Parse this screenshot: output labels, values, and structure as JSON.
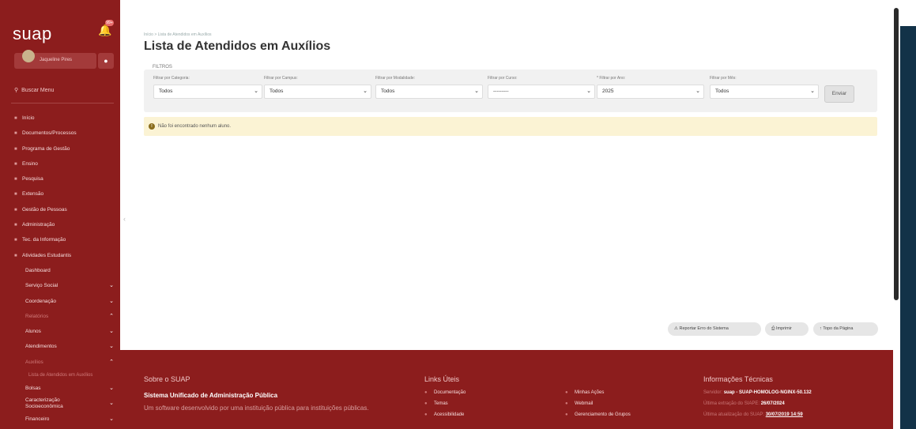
{
  "app": {
    "logo": "suap",
    "notif_badge": "99+"
  },
  "user": {
    "name": "Jaqueline Pires"
  },
  "sidebar": {
    "search_label": "Buscar Menu",
    "items": [
      {
        "label": "Início",
        "chevron": ""
      },
      {
        "label": "Documentos/Processos",
        "chevron": ""
      },
      {
        "label": "Programa de Gestão",
        "chevron": ""
      },
      {
        "label": "Ensino",
        "chevron": ""
      },
      {
        "label": "Pesquisa",
        "chevron": ""
      },
      {
        "label": "Extensão",
        "chevron": ""
      },
      {
        "label": "Gestão de Pessoas",
        "chevron": ""
      },
      {
        "label": "Administração",
        "chevron": ""
      },
      {
        "label": "Tec. da Informação",
        "chevron": ""
      },
      {
        "label": "Atividades Estudantis",
        "chevron": ""
      },
      {
        "label": "Dashboard",
        "chevron": ""
      },
      {
        "label": "Serviço Social",
        "chevron": "⌄"
      },
      {
        "label": "Coordenação",
        "chevron": "⌄"
      },
      {
        "label": "Relatórios",
        "chevron": "⌃"
      },
      {
        "label": "Alunos",
        "chevron": "⌄"
      },
      {
        "label": "Atendimentos",
        "chevron": "⌄"
      },
      {
        "label": "Auxílios",
        "chevron": "⌃"
      },
      {
        "label": "Lista de Atendidos em Auxílios",
        "chevron": ""
      },
      {
        "label": "Bolsas",
        "chevron": "⌄"
      },
      {
        "label": "Caracterização Socioeconômica",
        "chevron": "⌄"
      },
      {
        "label": "Financeiro",
        "chevron": "⌄"
      }
    ]
  },
  "breadcrumb": "Início > Lista de Atendidos em Auxílios",
  "page_title": "Lista de Atendidos em Auxílios",
  "filters": {
    "section_label": "FILTROS",
    "categoria": {
      "label": "Filtrar por Categoria:",
      "value": "Todos"
    },
    "campus": {
      "label": "Filtrar por Campus:",
      "value": "Todos"
    },
    "modalidade": {
      "label": "Filtrar por Modalidade:",
      "value": "Todos"
    },
    "curso": {
      "label": "Filtrar por Curso:",
      "value": "---------"
    },
    "ano": {
      "label": "* Filtrar por Ano:",
      "value": "2025"
    },
    "mes": {
      "label": "Filtrar por Mês:",
      "value": "Todos"
    },
    "submit": "Enviar"
  },
  "alert": "Não foi encontrado nenhum aluno.",
  "actions": {
    "report": "Reportar Erro do Sistema",
    "print": "Imprimir",
    "top": "Topo da Página"
  },
  "footer": {
    "about_title": "Sobre o SUAP",
    "about_name": "Sistema Unificado de Administração Pública",
    "about_desc": "Um software desenvolvido por uma instituição pública para instituições públicas.",
    "links_title": "Links Úteis",
    "links": [
      "Documentação",
      "Temas",
      "Acessibilidade",
      "Minhas Ações",
      "Webmail",
      "Gerenciamento de Grupos"
    ],
    "info_title": "Informações Técnicas",
    "server_label": "Servidor:",
    "server_value": "suap - SUAP-HOMOLOG-NGINX-50.132",
    "extract_label": "Última extração do SIAPE:",
    "extract_value": "26/07/2024",
    "update_label": "Última atualização do SUAP:",
    "update_value": "30/07/2019 14:59"
  },
  "colors": {
    "brand": "#8c1d1d",
    "alert_bg": "#fbf3d4",
    "right_panel": "#123248"
  }
}
